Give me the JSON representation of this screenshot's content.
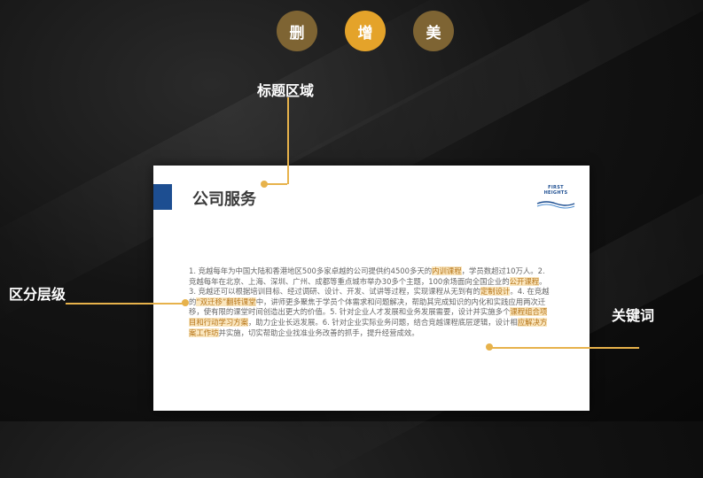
{
  "buttons": {
    "delete": "删",
    "add": "增",
    "beautify": "美"
  },
  "labels": {
    "title_area": "标题区域",
    "hierarchy": "区分层级",
    "keywords": "关键词"
  },
  "slide": {
    "title": "公司服务",
    "logo_text": "FIRST HEIGHTS",
    "paragraph": [
      {
        "text": "1. 竞越每年为中国大陆和香港地区500多家卓越的公司提供约4500多天的",
        "highlight": false
      },
      {
        "text": "内训课程",
        "highlight": true
      },
      {
        "text": "，学员数超过10万人。2. 竞越每年在北京、上海、深圳、广州、成都等重点城市举办30多个主题，100余场面向全国企业的",
        "highlight": false
      },
      {
        "text": "公开课程",
        "highlight": true
      },
      {
        "text": "。3. 竞越还可以根据培训目标、经过调研、设计、开发、试讲等过程，实现课程从无到有的",
        "highlight": false
      },
      {
        "text": "定制设计",
        "highlight": true
      },
      {
        "text": "。4. 在竞越的",
        "highlight": false
      },
      {
        "text": "“双迁移”翻转课堂",
        "highlight": true
      },
      {
        "text": "中，讲师更多聚焦于学员个体需求和问题解决，帮助其完成知识的内化和实践应用两次迁移，使有限的课堂时间创造出更大的价值。5. 针对企业人才发展和业务发展需要，设计并实施多个",
        "highlight": false
      },
      {
        "text": "课程组合项目和行动学习方案",
        "highlight": true
      },
      {
        "text": "，助力企业长远发展。6. 针对企业实际业务问题，结合竞越课程底层逻辑，设计相",
        "highlight": false
      },
      {
        "text": "应解决方案工作坊",
        "highlight": true
      },
      {
        "text": "并实施，切实帮助企业找准业务改善的抓手，提升经营成效。",
        "highlight": false
      }
    ]
  },
  "colors": {
    "accent": "#e7b24b",
    "brand_blue": "#1d4e91",
    "dark_gold": "#7e6433",
    "bright_gold": "#e4a32a"
  }
}
